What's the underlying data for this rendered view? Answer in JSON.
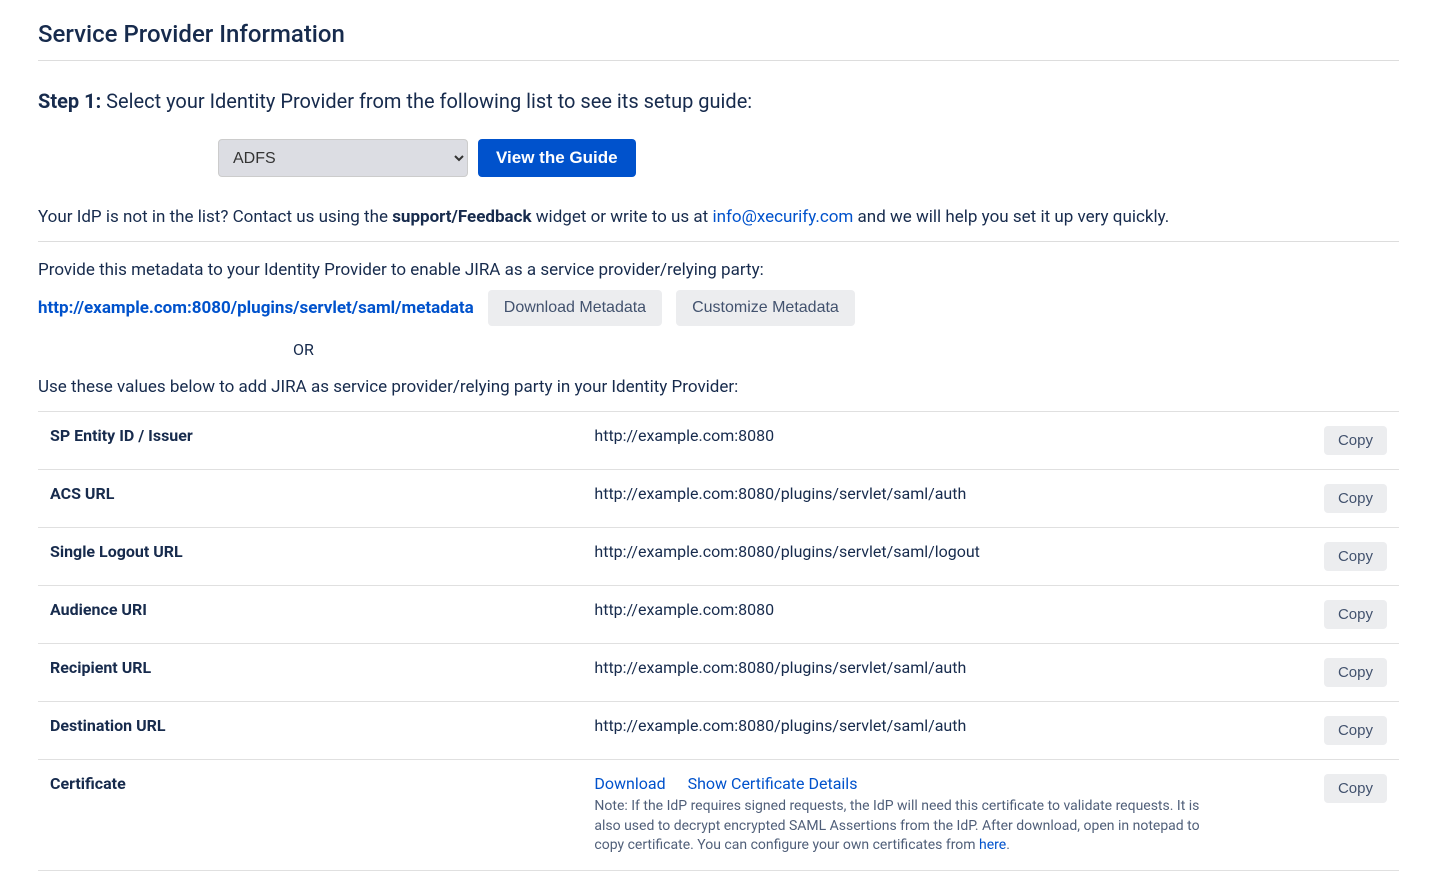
{
  "page_title": "Service Provider Information",
  "step1_label": "Step 1:",
  "step1_text": " Select your Identity Provider from the following list to see its setup guide:",
  "idp_select_value": "ADFS",
  "view_guide_label": "View the Guide",
  "help_prefix": "Your IdP is not in the list? Contact us using the ",
  "help_bold": "support/Feedback",
  "help_mid": " widget or write to us at ",
  "help_email": "info@xecurify.com",
  "help_suffix": " and we will help you set it up very quickly.",
  "metadata_intro": "Provide this metadata to your Identity Provider to enable JIRA as a service provider/relying party:",
  "metadata_url": "http://example.com:8080/plugins/servlet/saml/metadata",
  "download_metadata_label": "Download Metadata",
  "customize_metadata_label": "Customize Metadata",
  "or_text": "OR",
  "values_intro": "Use these values below to add JIRA as service provider/relying party in your Identity Provider:",
  "copy_label": "Copy",
  "rows": {
    "r0": {
      "label": "SP Entity ID / Issuer",
      "value": "http://example.com:8080"
    },
    "r1": {
      "label": "ACS URL",
      "value": "http://example.com:8080/plugins/servlet/saml/auth"
    },
    "r2": {
      "label": "Single Logout URL",
      "value": "http://example.com:8080/plugins/servlet/saml/logout"
    },
    "r3": {
      "label": "Audience URI",
      "value": "http://example.com:8080"
    },
    "r4": {
      "label": "Recipient URL",
      "value": "http://example.com:8080/plugins/servlet/saml/auth"
    },
    "r5": {
      "label": "Destination URL",
      "value": "http://example.com:8080/plugins/servlet/saml/auth"
    }
  },
  "cert": {
    "label": "Certificate",
    "download": "Download",
    "show_details": "Show Certificate Details",
    "note_prefix": "Note: If the IdP requires signed requests, the IdP will need this certificate to validate requests. It is also used to decrypt encrypted SAML Assertions from the IdP. After download, open in notepad to copy certificate. You can configure your own certificates from ",
    "here": "here",
    "note_suffix": "."
  }
}
